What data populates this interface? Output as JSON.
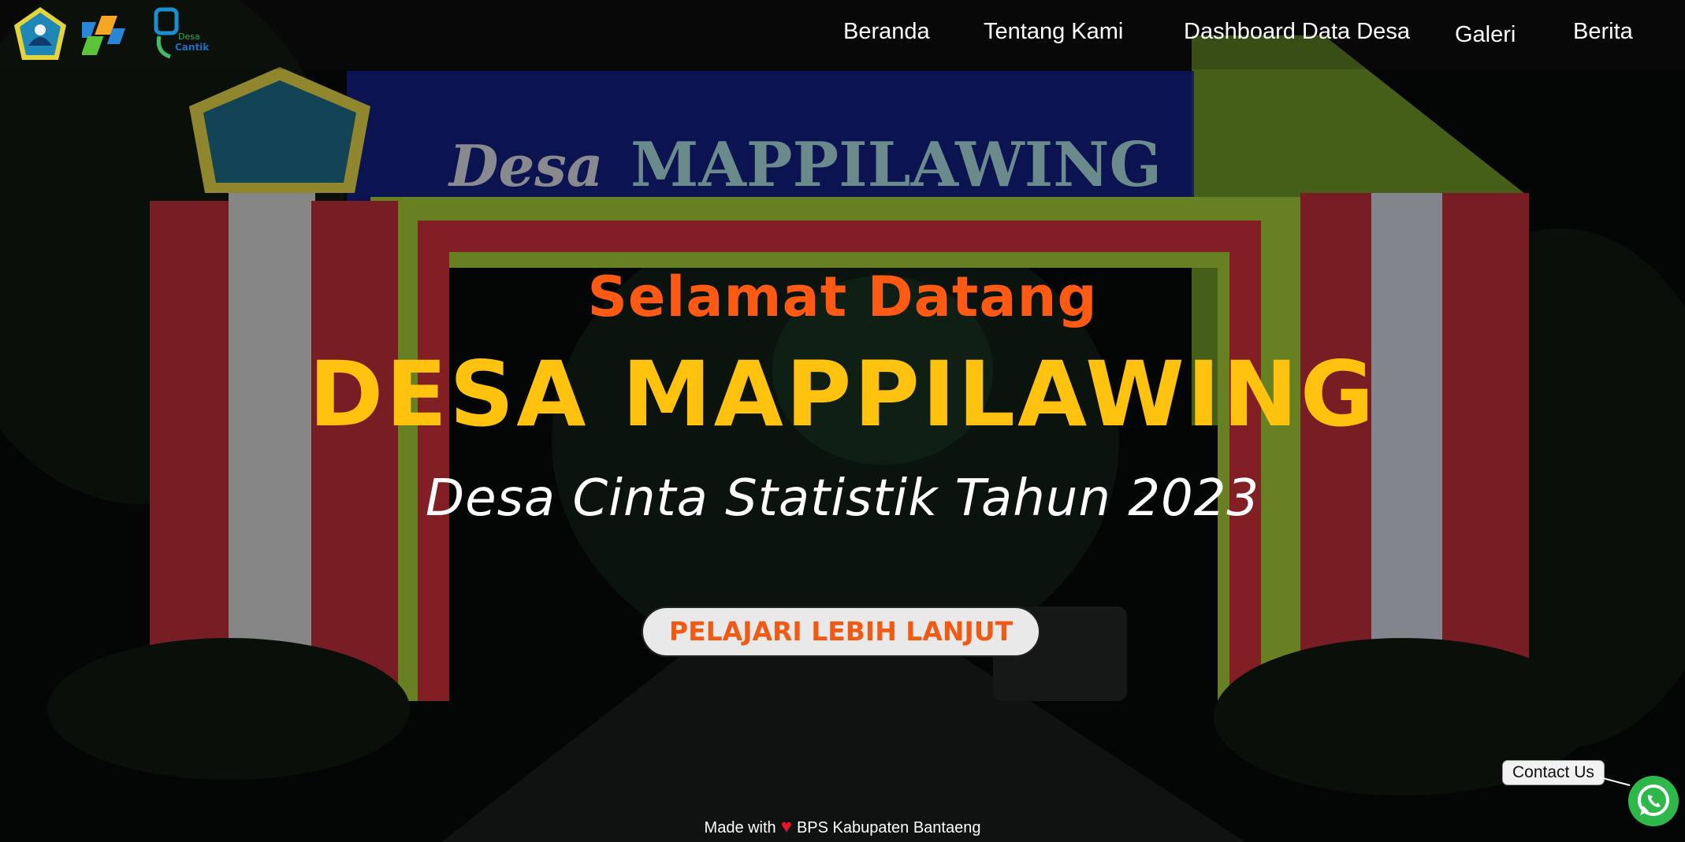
{
  "nav": {
    "items": [
      {
        "label": "Beranda"
      },
      {
        "label": "Tentang Kami"
      },
      {
        "label": "Dashboard Data Desa"
      },
      {
        "label": "Galeri"
      },
      {
        "label": "Berita"
      }
    ]
  },
  "logos": {
    "desa_cantik_line1": "Desa",
    "desa_cantik_line2": "Cantik"
  },
  "background_sign": {
    "word1": "Desa",
    "word2": "MAPPILAWING"
  },
  "hero": {
    "welcome": "Selamat Datang",
    "village_name": "DESA MAPPILAWING",
    "tagline": "Desa Cinta Statistik Tahun 2023",
    "cta_label": "PELAJARI LEBIH LANJUT"
  },
  "footer": {
    "made_with": "Made with",
    "heart": "♥",
    "org": "BPS Kabupaten Bantaeng"
  },
  "contact": {
    "label": "Contact Us"
  },
  "colors": {
    "welcome": "#ff5a13",
    "village_name": "#ffc20e",
    "cta_text": "#f05a14",
    "whatsapp": "#2fb84a"
  }
}
